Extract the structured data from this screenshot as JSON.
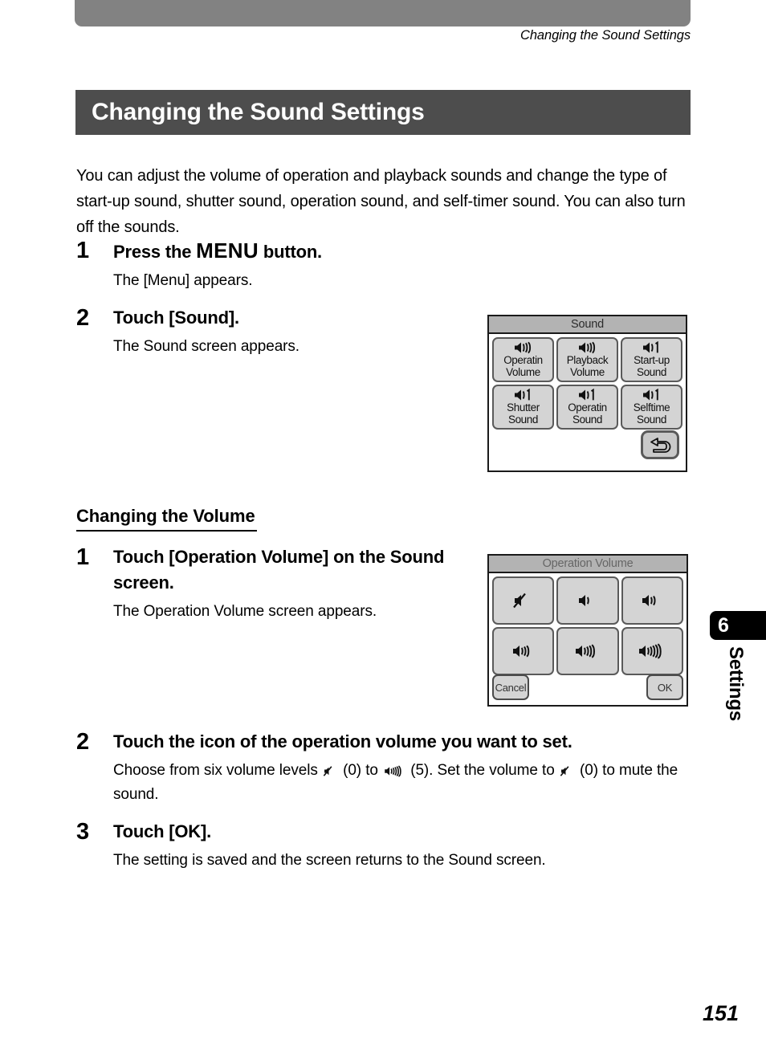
{
  "header": {
    "running_head": "Changing the Sound Settings"
  },
  "title": "Changing the Sound Settings",
  "intro": "You can adjust the volume of operation and playback sounds and change the type of start-up sound, shutter sound, operation sound, and self-timer sound. You can also turn off the sounds.",
  "steps_main": [
    {
      "num": "1",
      "title_before": "Press the ",
      "title_keyword": "MENU",
      "title_after": " button.",
      "desc": "The [Menu] appears."
    },
    {
      "num": "2",
      "title": "Touch [Sound].",
      "desc": "The Sound screen appears."
    }
  ],
  "subsection": {
    "heading": "Changing the Volume",
    "steps": [
      {
        "num": "1",
        "title": "Touch [Operation Volume] on the Sound screen.",
        "desc": "The Operation Volume screen appears."
      },
      {
        "num": "2",
        "title": "Touch the icon of the operation volume you want to set.",
        "desc_part1": "Choose from six volume levels ",
        "desc_part2": " (0) to ",
        "desc_part3": " (5). Set the volume to ",
        "desc_part4": " (0) to mute the sound.",
        "level_min": "0",
        "level_max": "5"
      },
      {
        "num": "3",
        "title": "Touch [OK].",
        "desc": "The setting is saved and the screen returns to the Sound screen."
      }
    ]
  },
  "sound_screen": {
    "title": "Sound",
    "buttons": [
      {
        "line1": "Operatin",
        "line2": "Volume",
        "icon": "speaker-volume-icon"
      },
      {
        "line1": "Playback",
        "line2": "Volume",
        "icon": "speaker-volume-icon"
      },
      {
        "line1": "Start-up",
        "line2": "Sound",
        "icon": "speaker-tone-icon"
      },
      {
        "line1": "Shutter",
        "line2": "Sound",
        "icon": "speaker-tone-icon"
      },
      {
        "line1": "Operatin",
        "line2": "Sound",
        "icon": "speaker-tone-icon"
      },
      {
        "line1": "Selftime",
        "line2": "Sound",
        "icon": "speaker-tone-icon"
      }
    ],
    "back_icon": "back-arrow-icon"
  },
  "volume_screen": {
    "title": "Operation Volume",
    "levels": [
      {
        "value": "0",
        "icon": "speaker-mute-icon"
      },
      {
        "value": "1",
        "icon": "speaker-wave-1-icon"
      },
      {
        "value": "2",
        "icon": "speaker-wave-2-icon"
      },
      {
        "value": "3",
        "icon": "speaker-wave-3-icon"
      },
      {
        "value": "4",
        "icon": "speaker-wave-4-icon"
      },
      {
        "value": "5",
        "icon": "speaker-wave-5-icon"
      }
    ],
    "cancel_label": "Cancel",
    "ok_label": "OK"
  },
  "thumb_tab": {
    "number": "6",
    "label": "Settings"
  },
  "page_number": "151",
  "colors": {
    "top_bar": "#828282",
    "title_bar": "#4d4d4d",
    "lcd_head": "#b3b3b3",
    "lcd_button": "#d4d4d4",
    "tab": "#000000"
  }
}
